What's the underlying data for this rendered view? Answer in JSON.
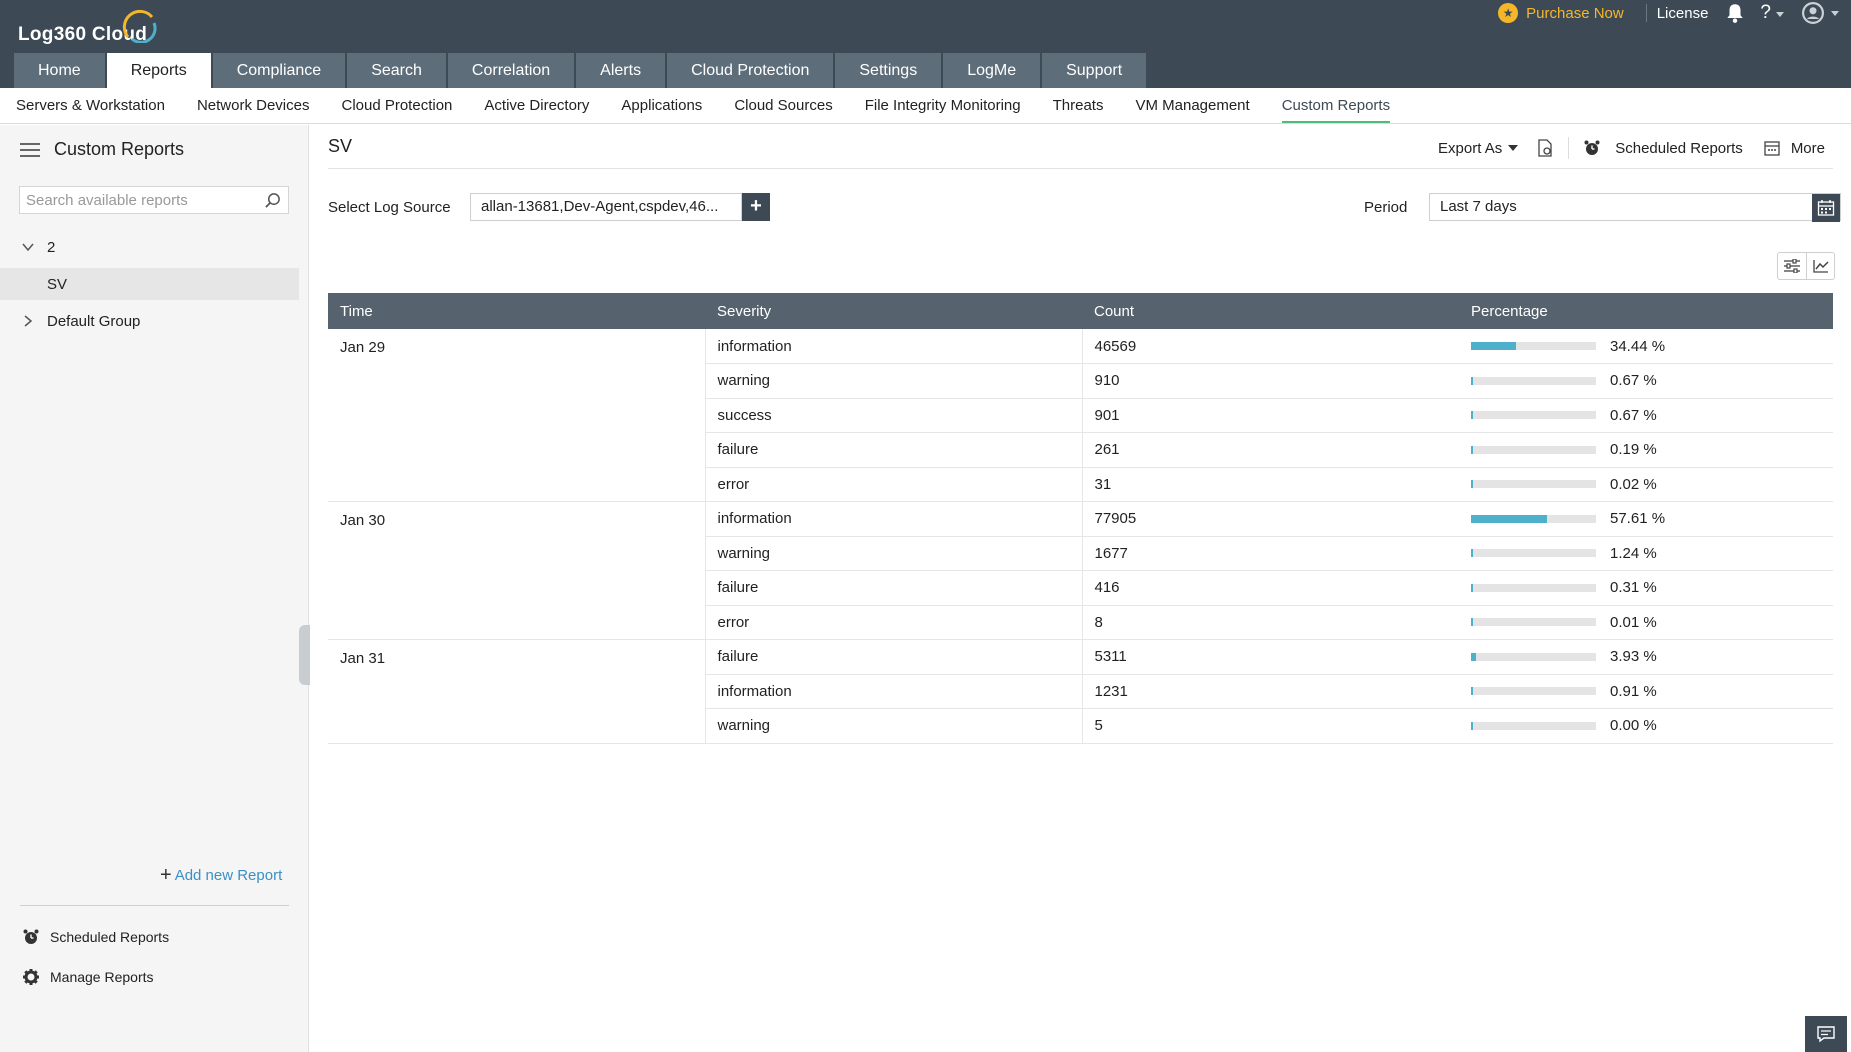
{
  "header": {
    "logo": "Log360 Cloud",
    "purchase_label": "Purchase Now",
    "license_label": "License",
    "help_label": "?",
    "colors": {
      "header_bg": "#3d4a55",
      "accent": "#f5b62a",
      "active_underline": "#4dbb7a",
      "bar_fill": "#4fb0cc"
    }
  },
  "main_nav": [
    {
      "label": "Home",
      "active": false
    },
    {
      "label": "Reports",
      "active": true
    },
    {
      "label": "Compliance",
      "active": false
    },
    {
      "label": "Search",
      "active": false
    },
    {
      "label": "Correlation",
      "active": false
    },
    {
      "label": "Alerts",
      "active": false
    },
    {
      "label": "Cloud Protection",
      "active": false
    },
    {
      "label": "Settings",
      "active": false
    },
    {
      "label": "LogMe",
      "active": false
    },
    {
      "label": "Support",
      "active": false
    }
  ],
  "sub_nav": [
    {
      "label": "Servers & Workstation",
      "active": false
    },
    {
      "label": "Network Devices",
      "active": false
    },
    {
      "label": "Cloud Protection",
      "active": false
    },
    {
      "label": "Active Directory",
      "active": false
    },
    {
      "label": "Applications",
      "active": false
    },
    {
      "label": "Cloud Sources",
      "active": false
    },
    {
      "label": "File Integrity Monitoring",
      "active": false
    },
    {
      "label": "Threats",
      "active": false
    },
    {
      "label": "VM Management",
      "active": false
    },
    {
      "label": "Custom Reports",
      "active": true
    }
  ],
  "sidebar": {
    "title": "Custom Reports",
    "search_placeholder": "Search available reports",
    "tree": [
      {
        "label": "2",
        "expanded": true,
        "children": [
          {
            "label": "SV",
            "selected": true
          }
        ]
      },
      {
        "label": "Default Group",
        "expanded": false
      }
    ],
    "add_report_label": "Add new Report",
    "scheduled_reports_label": "Scheduled Reports",
    "manage_reports_label": "Manage Reports"
  },
  "report": {
    "title": "SV",
    "export_label": "Export As",
    "scheduled_reports_label": "Scheduled Reports",
    "more_label": "More",
    "log_source_label": "Select Log Source",
    "log_source_value": "allan-13681,Dev-Agent,cspdev,46...",
    "period_label": "Period",
    "period_value": "Last 7 days"
  },
  "table": {
    "columns": [
      "Time",
      "Severity",
      "Count",
      "Percentage"
    ],
    "groups": [
      {
        "time": "Jan 29",
        "rows": [
          {
            "severity": "information",
            "count": "46569",
            "percent": "34.44 %",
            "fraction": 0.3444
          },
          {
            "severity": "warning",
            "count": "910",
            "percent": "0.67 %",
            "fraction": 0.0067
          },
          {
            "severity": "success",
            "count": "901",
            "percent": "0.67 %",
            "fraction": 0.0067
          },
          {
            "severity": "failure",
            "count": "261",
            "percent": "0.19 %",
            "fraction": 0.0019
          },
          {
            "severity": "error",
            "count": "31",
            "percent": "0.02 %",
            "fraction": 0.0002
          }
        ]
      },
      {
        "time": "Jan 30",
        "rows": [
          {
            "severity": "information",
            "count": "77905",
            "percent": "57.61 %",
            "fraction": 0.5761
          },
          {
            "severity": "warning",
            "count": "1677",
            "percent": "1.24 %",
            "fraction": 0.0124
          },
          {
            "severity": "failure",
            "count": "416",
            "percent": "0.31 %",
            "fraction": 0.0031
          },
          {
            "severity": "error",
            "count": "8",
            "percent": "0.01 %",
            "fraction": 0.0001
          }
        ]
      },
      {
        "time": "Jan 31",
        "rows": [
          {
            "severity": "failure",
            "count": "5311",
            "percent": "3.93 %",
            "fraction": 0.0393
          },
          {
            "severity": "information",
            "count": "1231",
            "percent": "0.91 %",
            "fraction": 0.0091
          },
          {
            "severity": "warning",
            "count": "5",
            "percent": "0.00 %",
            "fraction": 0.0
          }
        ]
      }
    ]
  }
}
